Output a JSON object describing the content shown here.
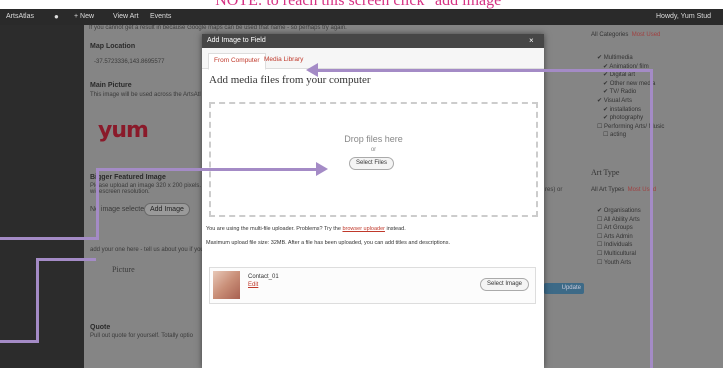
{
  "annotation": {
    "text": "NOTE: to reach this screen click \"add image\""
  },
  "admin_bar": {
    "site": "ArtsAtlas",
    "new_label": "New",
    "view_label": "View Art",
    "events_label": "Events",
    "howdy": "Howdy, Yum Stud"
  },
  "content": {
    "intro": "If you cannot get a result in because Google maps can be used that name - so perhaps try again.",
    "map_location_title": "Map Location",
    "map_location_value": "-37.5723336,143.8695577",
    "main_picture_title": "Main Picture",
    "main_picture_desc": "This image will be used across the ArtsAtl",
    "logo_text": "yum",
    "bigger_image_title": "Bigger Featured Image",
    "bigger_image_desc": "Please upload an image 320 x 200 pixels. It",
    "bigger_image_desc2": "widescreen resolution.",
    "no_image": "No image selected",
    "add_image": "Add Image",
    "blurb": "add your one here - tell us about you if you",
    "picture_label": "Picture",
    "quote_title": "Quote",
    "quote_desc": "Pull out quote for yourself. Totally optio",
    "update_btn": "Update",
    "res_note": "res) or"
  },
  "right_panel": {
    "all_categories": "All Categories",
    "most_used": "Most Used",
    "categories": [
      {
        "label": "Multimedia",
        "checked": true,
        "indent": 0
      },
      {
        "label": "Animation/ film",
        "checked": true,
        "indent": 1
      },
      {
        "label": "Digital art",
        "checked": true,
        "indent": 1
      },
      {
        "label": "Other new media",
        "checked": true,
        "indent": 1
      },
      {
        "label": "TV/ Radio",
        "checked": true,
        "indent": 1
      },
      {
        "label": "Visual Arts",
        "checked": true,
        "indent": 0
      },
      {
        "label": "installations",
        "checked": true,
        "indent": 1
      },
      {
        "label": "photography",
        "checked": true,
        "indent": 1
      },
      {
        "label": "Performing Arts/ Music",
        "checked": false,
        "indent": 0
      },
      {
        "label": "acting",
        "checked": false,
        "indent": 1
      }
    ],
    "art_type_title": "Art Type",
    "all_art_types": "All Art Types",
    "art_types": [
      {
        "label": "Organisations",
        "checked": true
      },
      {
        "label": "All Ability Arts",
        "checked": false
      },
      {
        "label": "Art Groups",
        "checked": false
      },
      {
        "label": "Arts Admin",
        "checked": false
      },
      {
        "label": "Individuals",
        "checked": false
      },
      {
        "label": "Multicultural",
        "checked": false
      },
      {
        "label": "Youth Arts",
        "checked": false
      }
    ]
  },
  "modal": {
    "title": "Add Image to Field",
    "close": "×",
    "tab_computer": "From Computer",
    "tab_library": "Media Library",
    "heading": "Add media files from your computer",
    "drop_text": "Drop files here",
    "or_text": "or",
    "select_files": "Select Files",
    "uploader_note_pre": "You are using the multi-file uploader. Problems? Try the",
    "uploader_link": "browser uploader",
    "uploader_note_post": "instead.",
    "max_size": "Maximum upload file size: 32MB. After a file has been uploaded, you can add titles and descriptions.",
    "file_name": "Contact_01",
    "edit_link": "Edit",
    "select_image": "Select Image"
  },
  "colors": {
    "accent_pink": "#d63384",
    "arrow": "#a48bc6",
    "link_red": "#c0392b"
  }
}
